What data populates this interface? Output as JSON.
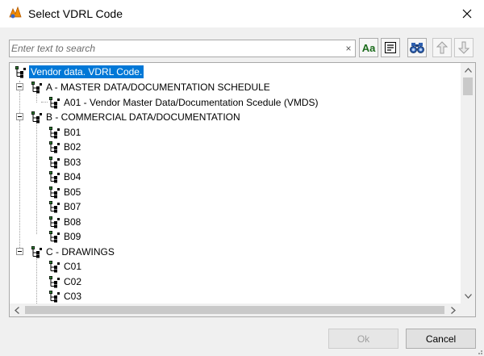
{
  "window": {
    "title": "Select VDRL Code",
    "close_glyph": "✕"
  },
  "search": {
    "placeholder": "Enter text to search",
    "value": "",
    "clear_glyph": "×"
  },
  "toolbar": {
    "match_case_label": "Aa"
  },
  "tree": {
    "root": "Vendor data. VDRL Code.",
    "group_a": "A - MASTER DATA/DOCUMENTATION SCHEDULE",
    "a01": "A01 - Vendor Master Data/Documentation Scedule (VMDS)",
    "group_b": "B - COMMERCIAL DATA/DOCUMENTATION",
    "b_items": [
      "B01",
      "B02",
      "B03",
      "B04",
      "B05",
      "B07",
      "B08",
      "B09"
    ],
    "group_c": "C - DRAWINGS",
    "c_items": [
      "C01",
      "C02",
      "C03"
    ]
  },
  "buttons": {
    "ok": "Ok",
    "cancel": "Cancel"
  },
  "colors": {
    "selection": "#0078d7",
    "tree_icon": "#000000",
    "tree_icon_accent": "#2e7d32",
    "app_icon_accent": "#f28c00"
  }
}
